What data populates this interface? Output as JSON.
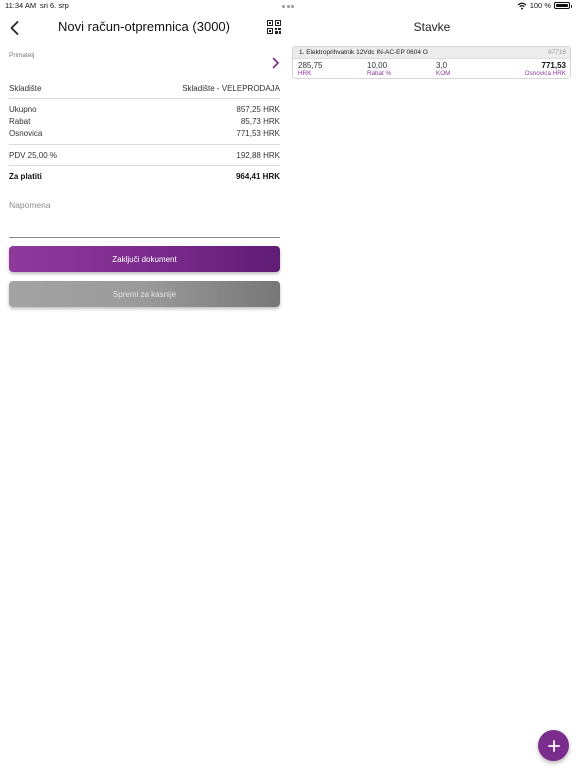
{
  "status_bar": {
    "time": "11:34 AM",
    "date": "sri 6. srp",
    "battery": "100 %",
    "battery_level": 1.0
  },
  "left": {
    "title": "Novi račun-otpremnica (3000)",
    "recipient_label": "Primatelj",
    "warehouse": {
      "label": "Skladište",
      "value": "Skladište - VELEPRODAJA"
    },
    "totals": [
      {
        "label": "Ukupno",
        "value": "857,25 HRK"
      },
      {
        "label": "Rabat",
        "value": "85,73 HRK"
      },
      {
        "label": "Osnovica",
        "value": "771,53 HRK"
      }
    ],
    "vat": {
      "label": "PDV 25,00 %",
      "value": "192,88 HRK"
    },
    "to_pay": {
      "label": "Za platiti",
      "value": "964,41 HRK"
    },
    "note_placeholder": "Napomena",
    "finish_button": "Zaključi dokument",
    "save_button": "Spremi za kasnije"
  },
  "right": {
    "title": "Stavke",
    "items": [
      {
        "name": "1.  Elektroprihvatnik 12Vdc IN-AC-EP 0604 O",
        "code": "97716",
        "price": "285,75",
        "price_label": "HRK",
        "discount": "10,00",
        "discount_label": "Rabat %",
        "qty": "3,0",
        "qty_label": "KOM",
        "base": "771,53",
        "base_label": "Osnovica HRK"
      }
    ]
  },
  "icons": {
    "back": "chevron-left-icon",
    "qr": "qr-code-icon",
    "recipient": "chevron-right-icon",
    "add": "plus-icon",
    "wifi": "wifi-icon",
    "battery": "battery-icon"
  },
  "colors": {
    "accent": "#7b2d8d",
    "secondary_button": "#9a9a9a"
  }
}
